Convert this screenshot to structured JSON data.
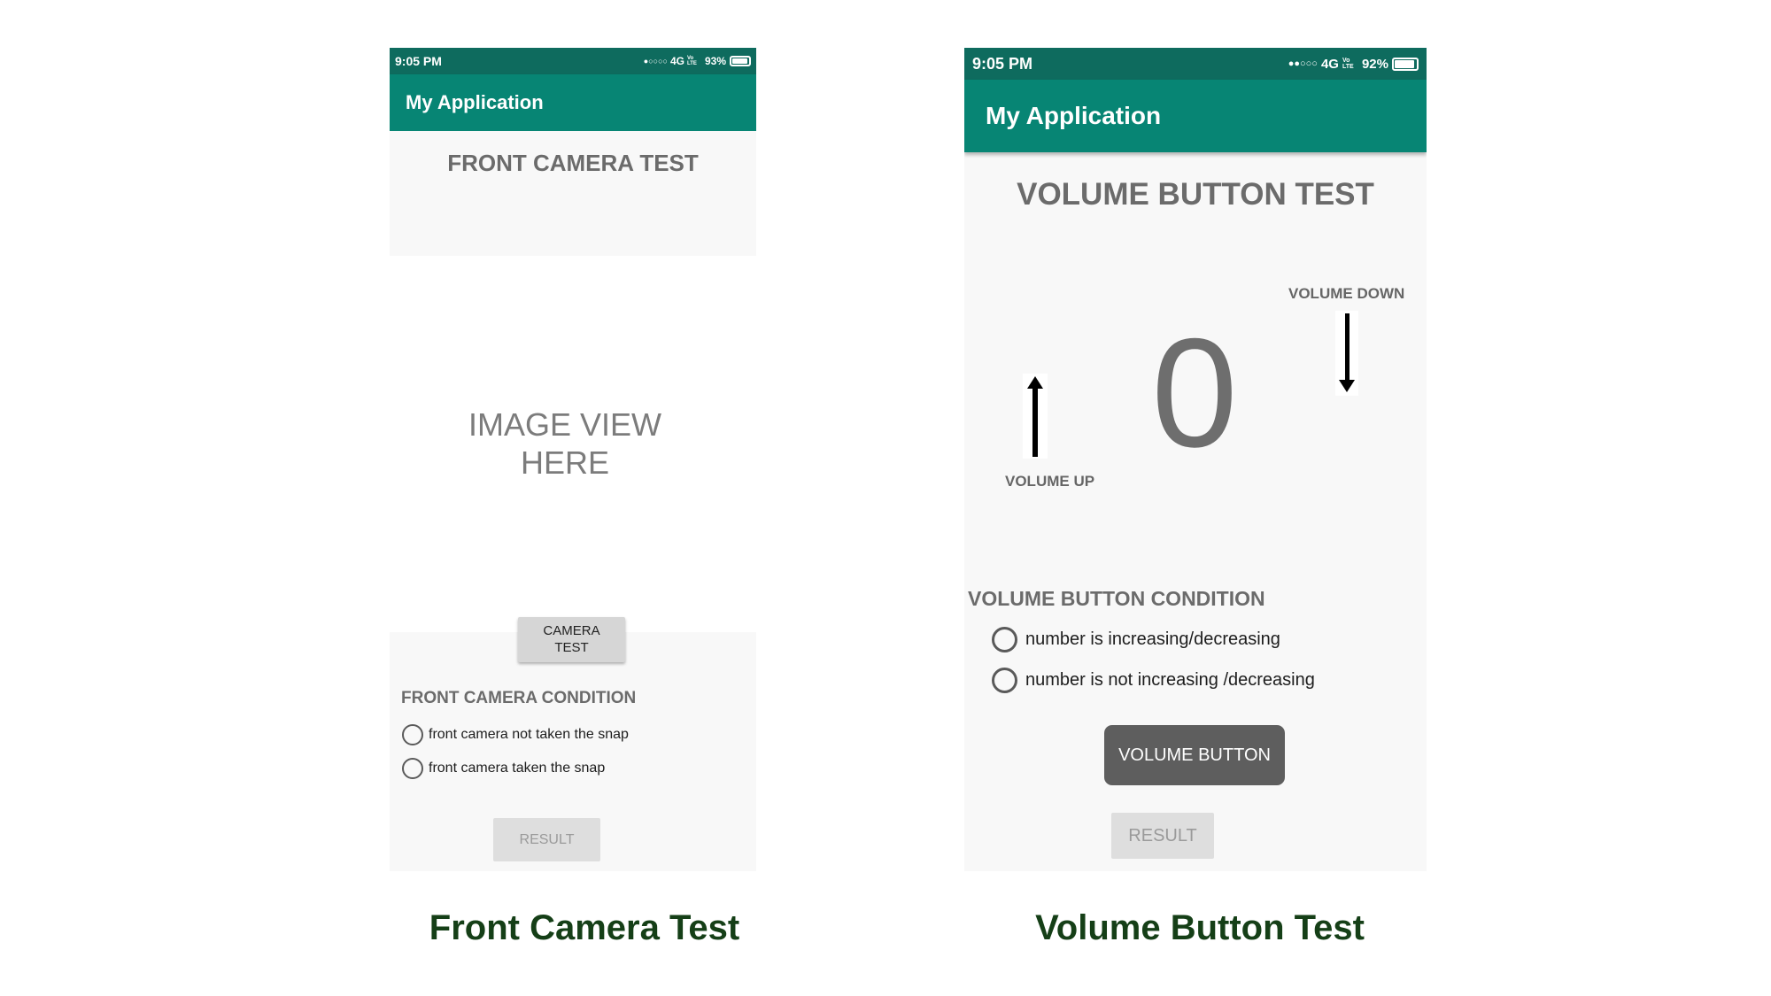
{
  "left_phone": {
    "status_bar": {
      "time": "9:05 PM",
      "network": "4G",
      "lte": "Vo LTE",
      "battery_percent_label": "93%",
      "battery_level": 0.93
    },
    "app_title": "My Application",
    "screen_title": "FRONT CAMERA TEST",
    "image_view": {
      "line1": "IMAGE VIEW",
      "line2": "HERE"
    },
    "camera_button": {
      "line1": "CAMERA",
      "line2": "TEST"
    },
    "condition_heading": "FRONT CAMERA CONDITION",
    "options": [
      "front camera not taken the snap",
      "front camera taken the snap"
    ],
    "result_button": "RESULT"
  },
  "right_phone": {
    "status_bar": {
      "time": "9:05 PM",
      "network": "4G",
      "lte": "Vo LTE",
      "battery_percent_label": "92%",
      "battery_level": 0.92
    },
    "app_title": "My Application",
    "screen_title": "VOLUME BUTTON TEST",
    "volume_down_label": "VOLUME DOWN",
    "volume_up_label": "VOLUME UP",
    "counter_value": "0",
    "condition_heading": "VOLUME BUTTON CONDITION",
    "options": [
      "number is increasing/decreasing",
      "number is not increasing /decreasing"
    ],
    "volume_button": "VOLUME BUTTON",
    "result_button": "RESULT"
  },
  "captions": {
    "left": "Front Camera Test",
    "right": "Volume Button Test"
  },
  "colors": {
    "status_bar": "#0e6b5e",
    "app_bar": "#078574",
    "caption_text": "#153f17",
    "volume_button_bg": "#5e5e5e",
    "camera_button_bg": "#d6d6d6",
    "result_button_bg": "#dedede"
  }
}
